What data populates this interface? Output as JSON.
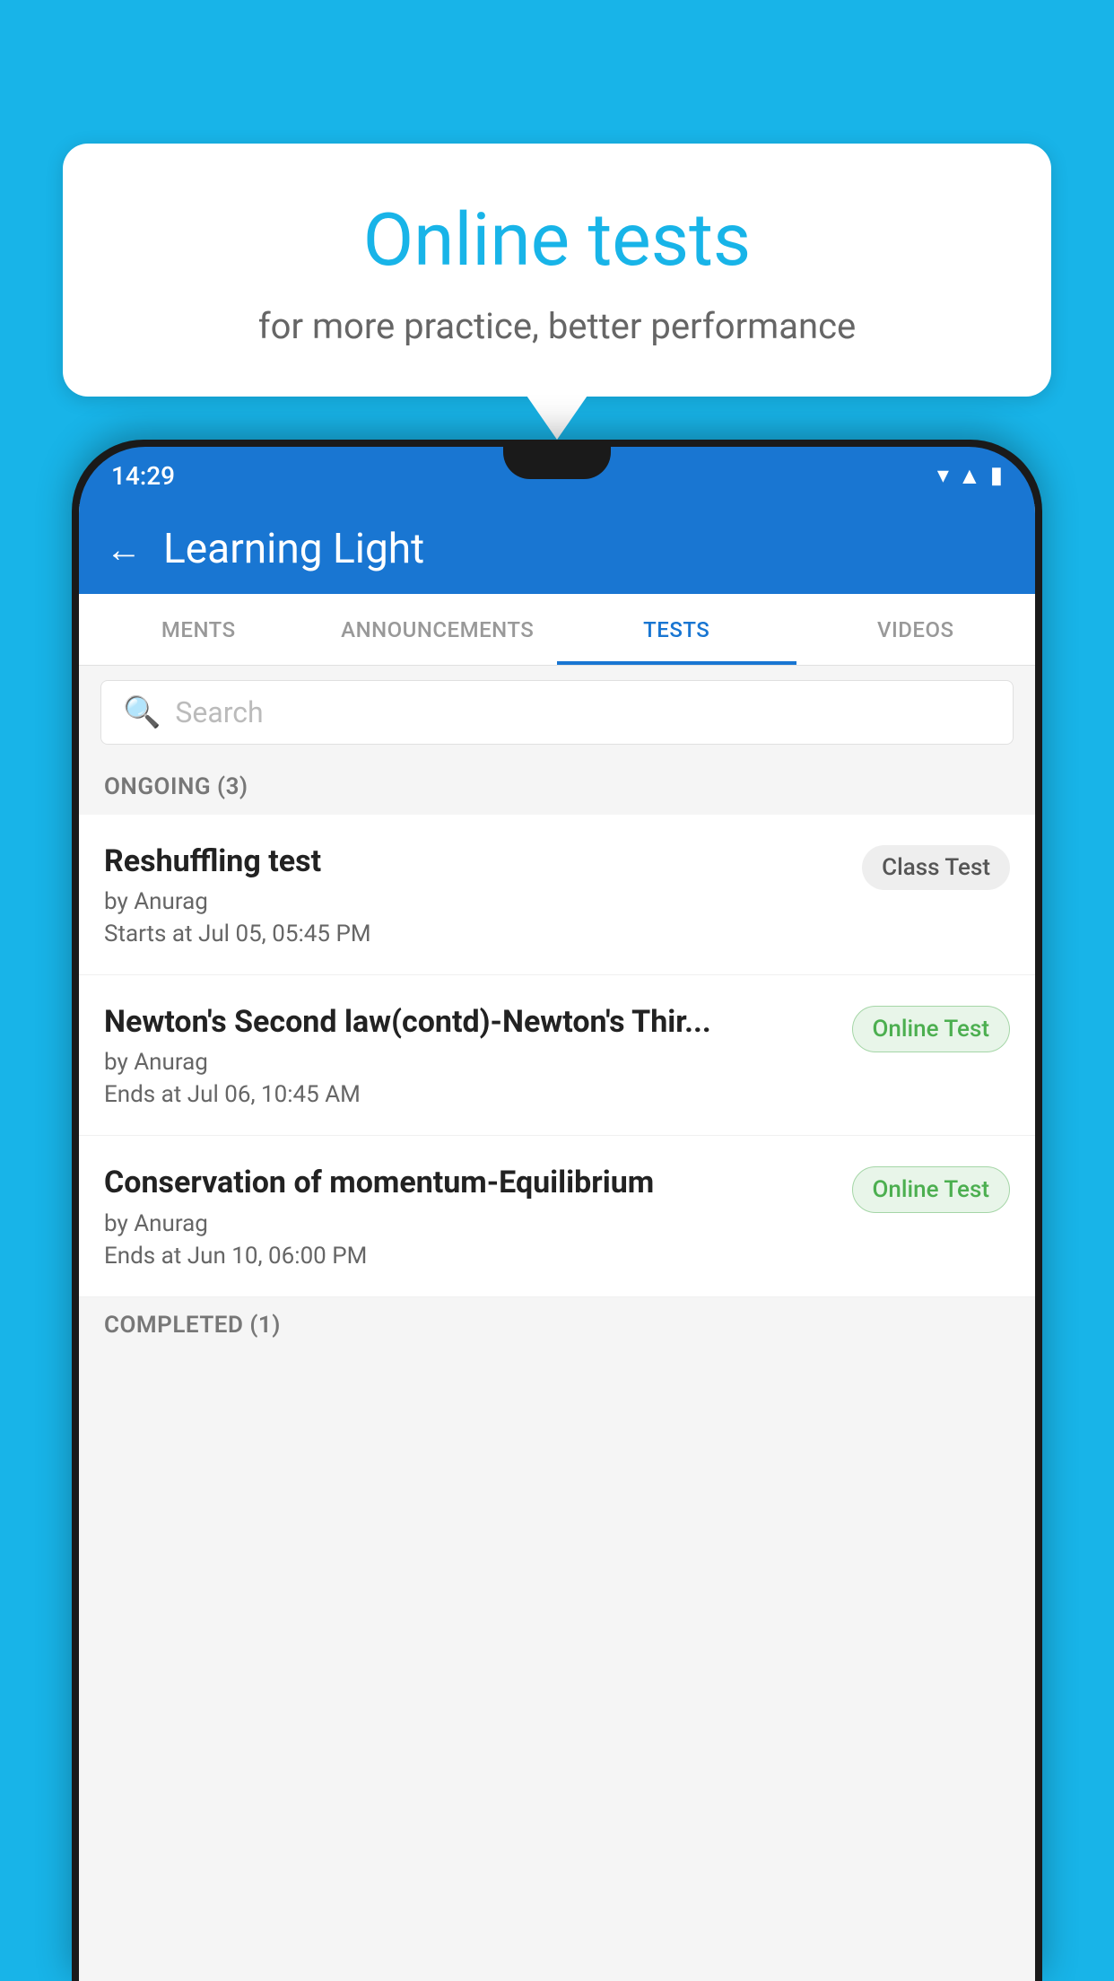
{
  "background_color": "#18b4e8",
  "bubble": {
    "title": "Online tests",
    "subtitle": "for more practice, better performance"
  },
  "phone": {
    "status_bar": {
      "time": "14:29",
      "icons": [
        "wifi",
        "signal",
        "battery"
      ]
    },
    "app_bar": {
      "title": "Learning Light",
      "back_label": "←"
    },
    "tabs": [
      {
        "label": "MENTS",
        "active": false
      },
      {
        "label": "ANNOUNCEMENTS",
        "active": false
      },
      {
        "label": "TESTS",
        "active": true
      },
      {
        "label": "VIDEOS",
        "active": false
      }
    ],
    "search": {
      "placeholder": "Search"
    },
    "sections": [
      {
        "header": "ONGOING (3)",
        "tests": [
          {
            "title": "Reshuffling test",
            "by": "by Anurag",
            "date": "Starts at  Jul 05, 05:45 PM",
            "badge": "Class Test",
            "badge_type": "class"
          },
          {
            "title": "Newton's Second law(contd)-Newton's Thir...",
            "by": "by Anurag",
            "date": "Ends at  Jul 06, 10:45 AM",
            "badge": "Online Test",
            "badge_type": "online"
          },
          {
            "title": "Conservation of momentum-Equilibrium",
            "by": "by Anurag",
            "date": "Ends at  Jun 10, 06:00 PM",
            "badge": "Online Test",
            "badge_type": "online"
          }
        ]
      }
    ],
    "completed_header": "COMPLETED (1)"
  }
}
